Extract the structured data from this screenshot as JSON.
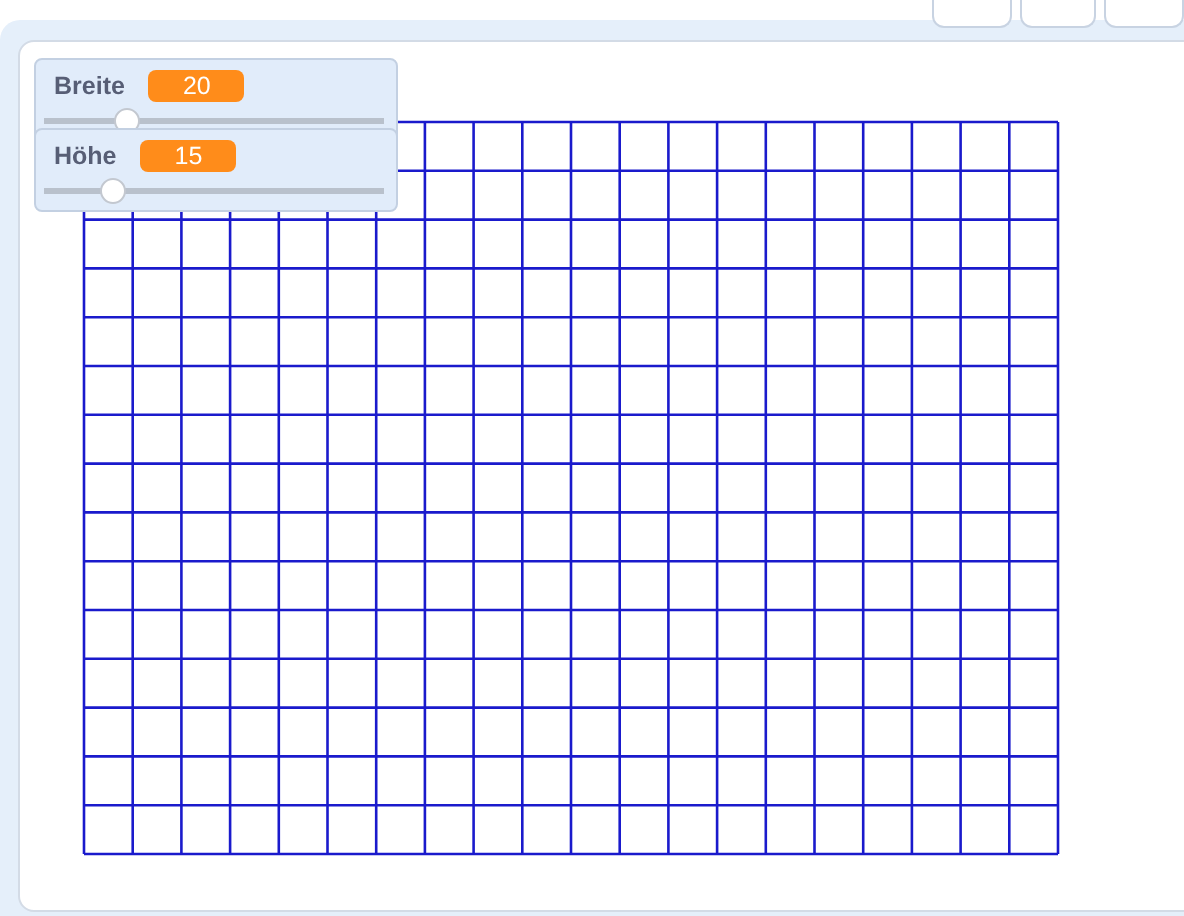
{
  "monitors": [
    {
      "label": "Breite",
      "value": "20",
      "level": 0.22
    },
    {
      "label": "Höhe",
      "value": "15",
      "level": 0.18
    }
  ]
}
